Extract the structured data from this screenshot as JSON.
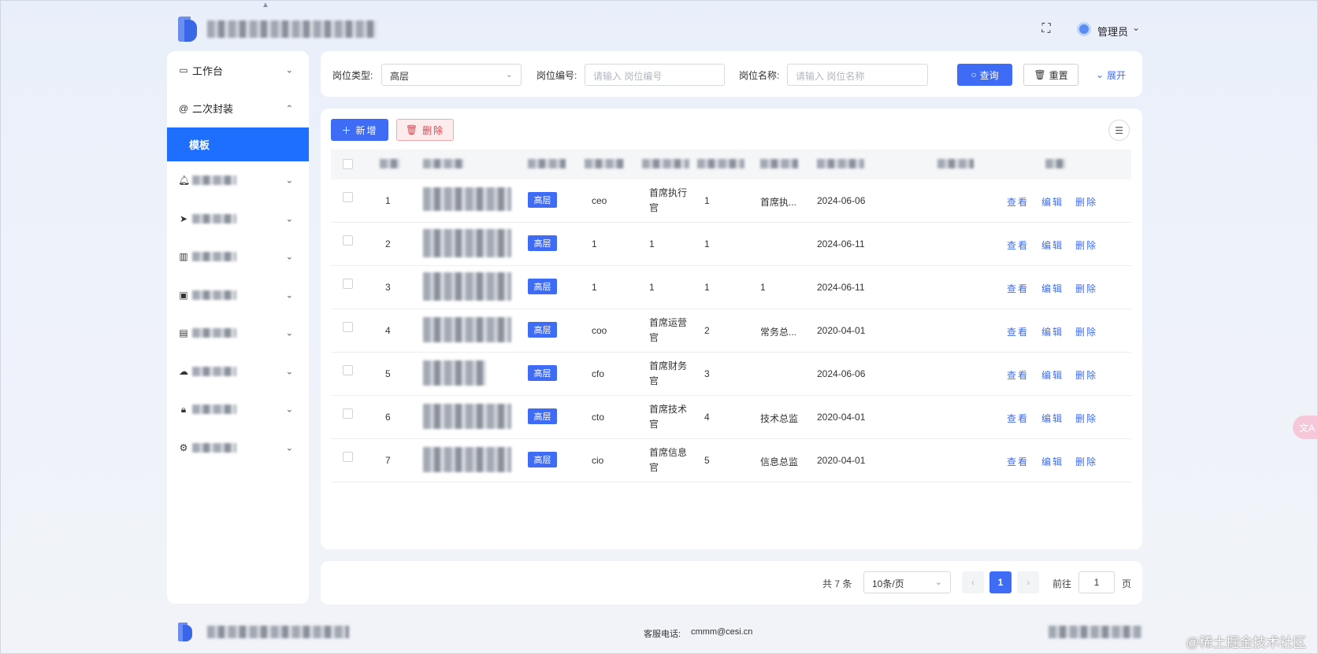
{
  "header": {
    "admin_name": "管理员"
  },
  "sidebar": {
    "items": [
      {
        "label": "工作台",
        "icon": "monitor-icon"
      },
      {
        "label": "二次封装",
        "icon": "at-circle-icon",
        "expanded": true,
        "children": [
          {
            "label": "模板",
            "active": true
          }
        ]
      },
      {
        "label": "",
        "icon": "bell-icon"
      },
      {
        "label": "",
        "icon": "send-icon"
      },
      {
        "label": "",
        "icon": "bar-chart-icon"
      },
      {
        "label": "",
        "icon": "wallet-icon"
      },
      {
        "label": "",
        "icon": "document-icon"
      },
      {
        "label": "",
        "icon": "cloud-icon"
      },
      {
        "label": "",
        "icon": "lock-icon"
      },
      {
        "label": "",
        "icon": "gear-icon"
      }
    ]
  },
  "filters": {
    "type_label": "岗位类型:",
    "type_value": "高层",
    "code_label": "岗位编号:",
    "code_placeholder": "请输入 岗位编号",
    "name_label": "岗位名称:",
    "name_placeholder": "请输入 岗位名称",
    "search_label": "查询",
    "reset_label": "重置",
    "expand_label": "展开"
  },
  "toolbar": {
    "add_label": "新增",
    "delete_label": "删除"
  },
  "table": {
    "rows": [
      {
        "index": "1",
        "tag": "高层",
        "code": "ceo",
        "name": [
          "首席执行",
          "官"
        ],
        "sort": "1",
        "remark": "首席执...",
        "date": "2024-06-06"
      },
      {
        "index": "2",
        "tag": "高层",
        "code": "1",
        "name": [
          "1"
        ],
        "sort": "1",
        "remark": "",
        "date": "2024-06-11"
      },
      {
        "index": "3",
        "tag": "高层",
        "code": "1",
        "name": [
          "1"
        ],
        "sort": "1",
        "remark": "1",
        "date": "2024-06-11"
      },
      {
        "index": "4",
        "tag": "高层",
        "code": "coo",
        "name": [
          "首席运营",
          "官"
        ],
        "sort": "2",
        "remark": "常务总...",
        "date": "2020-04-01"
      },
      {
        "index": "5",
        "tag": "高层",
        "code": "cfo",
        "name": [
          "首席财务",
          "官"
        ],
        "sort": "3",
        "remark": "",
        "date": "2024-06-06"
      },
      {
        "index": "6",
        "tag": "高层",
        "code": "cto",
        "name": [
          "首席技术",
          "官"
        ],
        "sort": "4",
        "remark": "技术总监",
        "date": "2020-04-01"
      },
      {
        "index": "7",
        "tag": "高层",
        "code": "cio",
        "name": [
          "首席信息",
          "官"
        ],
        "sort": "5",
        "remark": "信息总监",
        "date": "2020-04-01"
      }
    ],
    "actions": {
      "view": "查看",
      "edit": "编辑",
      "delete": "删除"
    }
  },
  "pagination": {
    "total": "共 7 条",
    "page_size": "10条/页",
    "current": "1",
    "goto_label": "前往",
    "goto_value": "1",
    "page_suffix": "页"
  },
  "footer": {
    "service_label": "客服电话:",
    "service_value": "cmmm@cesi.cn"
  },
  "watermark": "@稀土掘金技术社区"
}
